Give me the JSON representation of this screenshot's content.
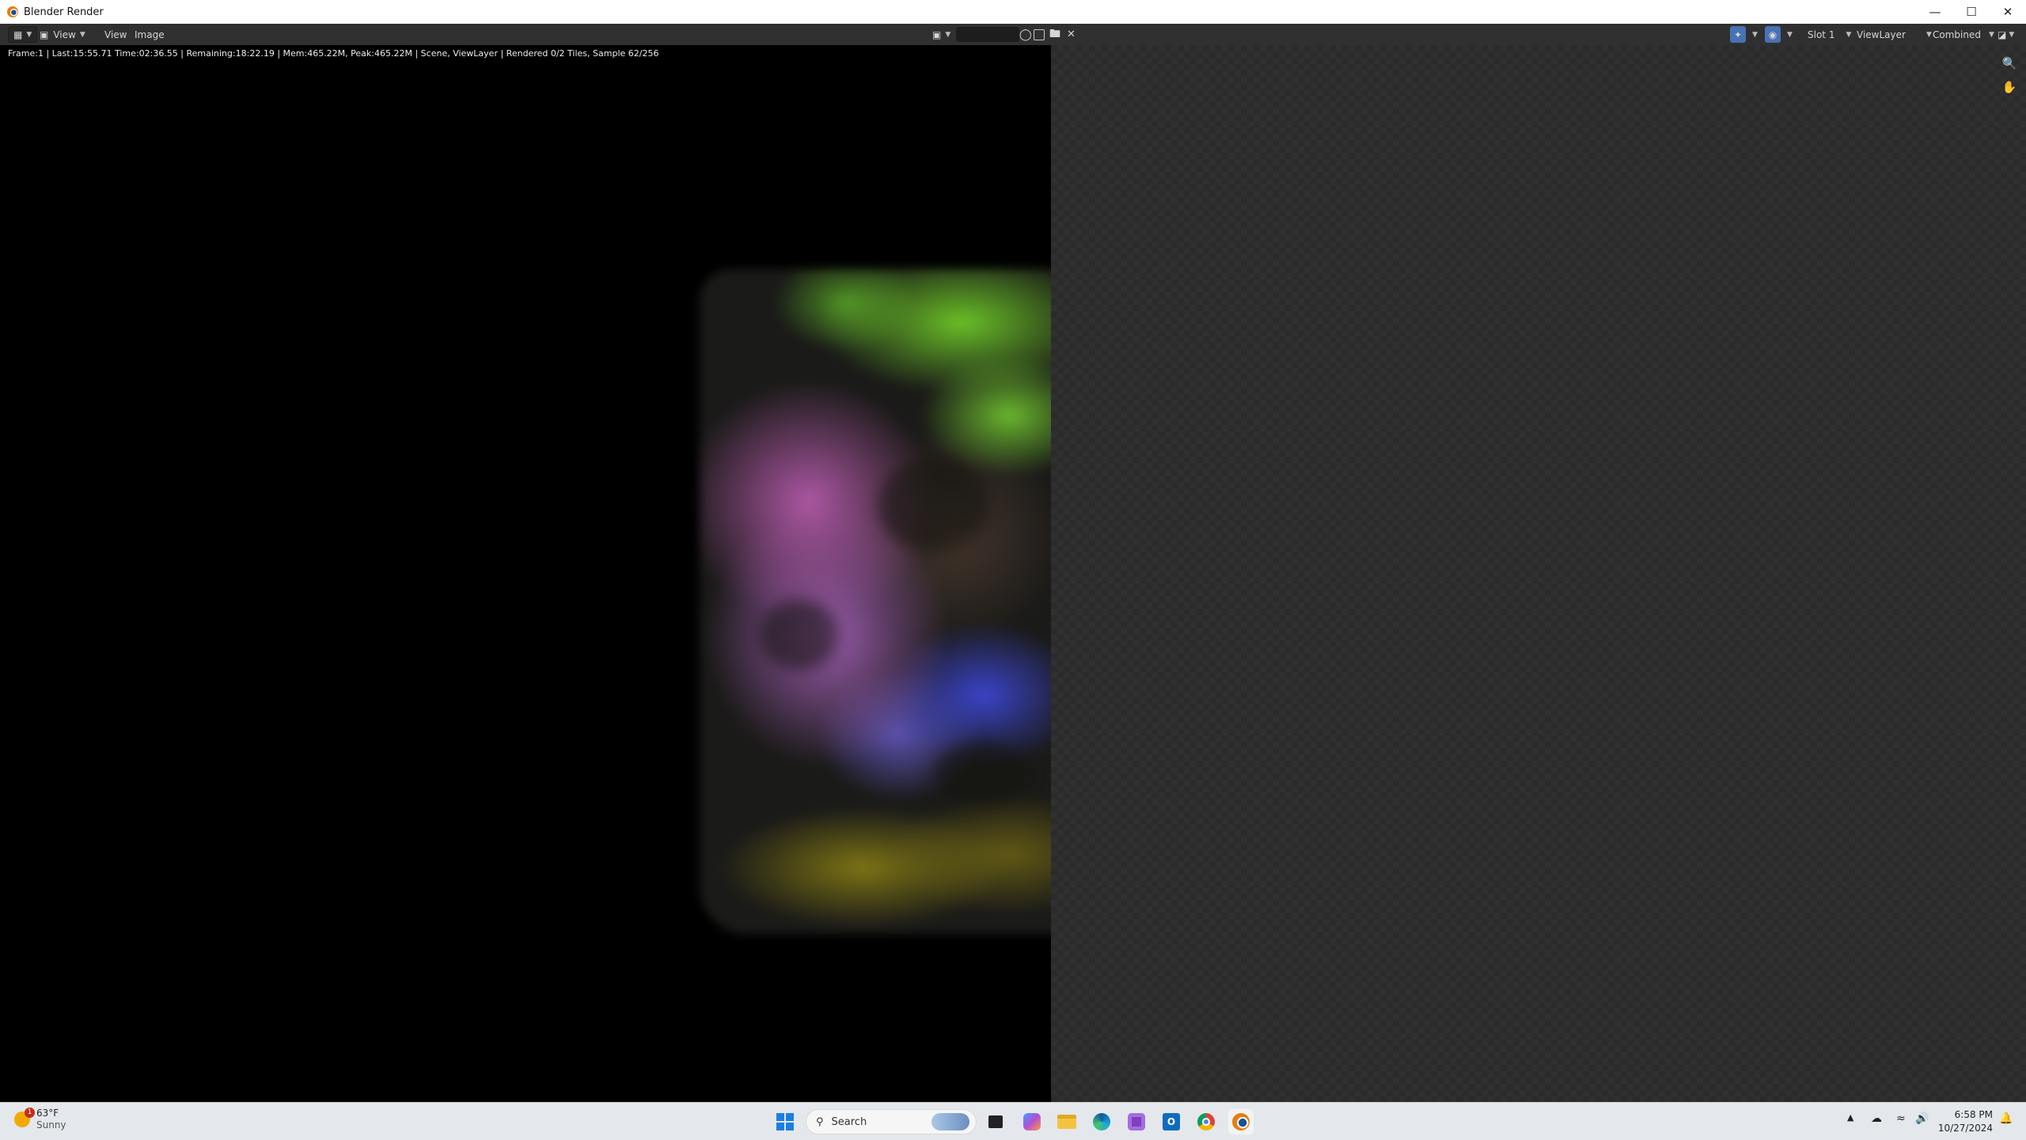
{
  "window": {
    "title": "Blender Render"
  },
  "header": {
    "menus": [
      "View",
      "View",
      "Image"
    ],
    "slot": "Slot 1",
    "view_layer": "ViewLayer",
    "pass": "Combined"
  },
  "status_text": "Frame:1 | Last:15:55.71 Time:02:36.55 | Remaining:18:22.19 | Mem:465.22M, Peak:465.22M | Scene, ViewLayer | Rendered 0/2 Tiles, Sample 62/256",
  "taskbar": {
    "weather_temp": "63°F",
    "weather_desc": "Sunny",
    "weather_badge": "1",
    "search_placeholder": "Search",
    "time": "6:58 PM",
    "date": "10/27/2024"
  },
  "icons": [
    "blender-icon",
    "editor-type-icon",
    "image-icon",
    "shield-icon",
    "duplicate-icon",
    "folder-icon",
    "close-icon",
    "gizmo-icon",
    "overlay-icon",
    "display-channels-icon",
    "zoom-icon",
    "hand-icon",
    "windows-start-icon",
    "search-icon",
    "task-view-icon",
    "copilot-icon",
    "file-explorer-icon",
    "edge-icon",
    "photos-icon",
    "outlook-icon",
    "chrome-icon",
    "blender-taskbar-icon",
    "chevron-up-icon",
    "onedrive-icon",
    "wifi-icon",
    "volume-icon",
    "notification-bell-icon"
  ]
}
